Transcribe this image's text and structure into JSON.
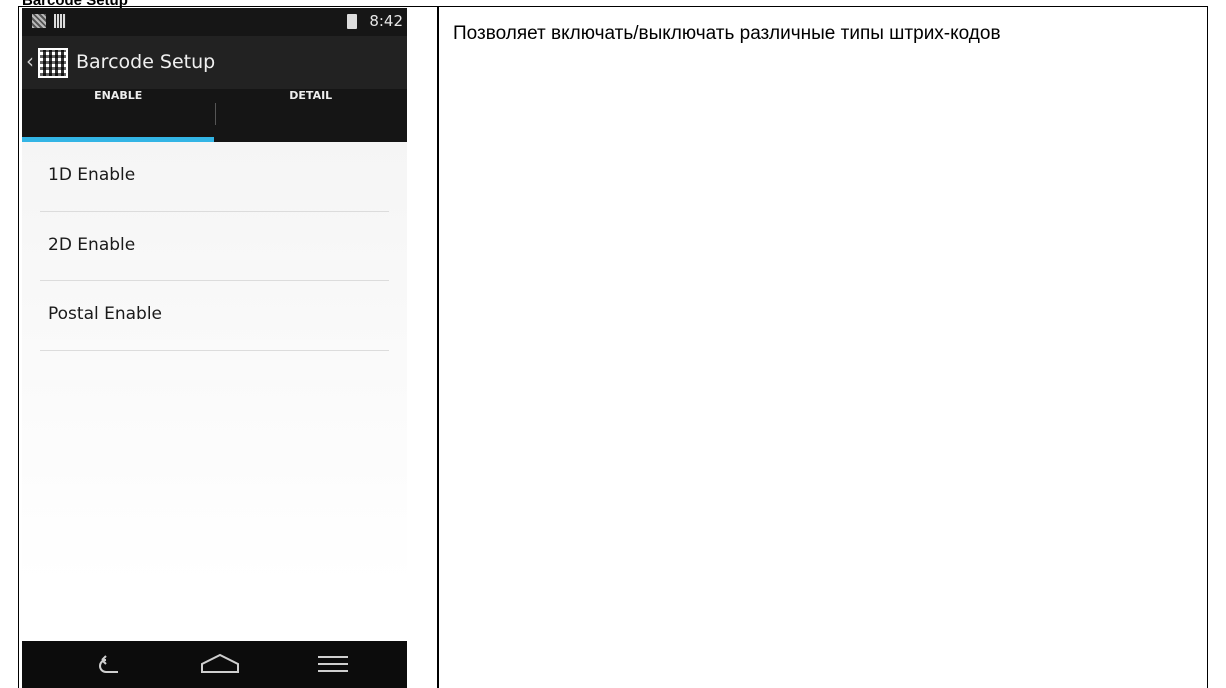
{
  "document": {
    "heading": "Barcode Setup",
    "description": "Позволяет включать/выключать различные типы штрих-кодов"
  },
  "phone": {
    "status_bar": {
      "time": "8:42",
      "icons": [
        "qr-notification-icon",
        "barcode-notification-icon",
        "battery-icon"
      ]
    },
    "action_bar": {
      "title": "Barcode Setup",
      "app_icon": "qr-code-icon",
      "back": "chevron-left-icon"
    },
    "tabs": [
      {
        "label": "ENABLE",
        "selected": true
      },
      {
        "label": "DETAIL",
        "selected": false
      }
    ],
    "list_items": [
      {
        "label": "1D Enable"
      },
      {
        "label": "2D Enable"
      },
      {
        "label": "Postal Enable"
      }
    ],
    "nav_bar": {
      "buttons": [
        "back-icon",
        "home-icon",
        "menu-icon"
      ]
    },
    "colors": {
      "tab_indicator": "#33b5e5",
      "action_bar": "#222222",
      "status_bar": "#161616"
    }
  }
}
